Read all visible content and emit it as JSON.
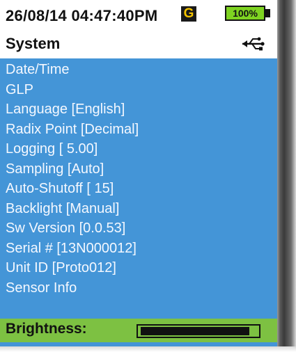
{
  "status": {
    "datetime": "26/08/14  04:47:40PM",
    "g_badge": "G",
    "battery": "100%"
  },
  "header": {
    "title": "System",
    "icon": "usb-icon"
  },
  "menu": {
    "items": [
      {
        "label": "Date/Time"
      },
      {
        "label": "GLP"
      },
      {
        "label": "Language [English]"
      },
      {
        "label": "Radix Point [Decimal]"
      },
      {
        "label": "Logging [ 5.00]"
      },
      {
        "label": "Sampling [Auto]"
      },
      {
        "label": "Auto-Shutoff [ 15]"
      },
      {
        "label": "Backlight [Manual]"
      },
      {
        "label": "Sw Version [0.0.53]"
      },
      {
        "label": "Serial # [13N000012]"
      },
      {
        "label": "Unit ID [Proto012]"
      },
      {
        "label": "Sensor Info"
      }
    ]
  },
  "brightness": {
    "label": "Brightness:",
    "level": 0.94
  },
  "colors": {
    "menu_bg": "#4495d7",
    "selected_bg": "#7dc142",
    "battery_fill": "#7ed321",
    "g_badge_text": "#f5c400"
  }
}
